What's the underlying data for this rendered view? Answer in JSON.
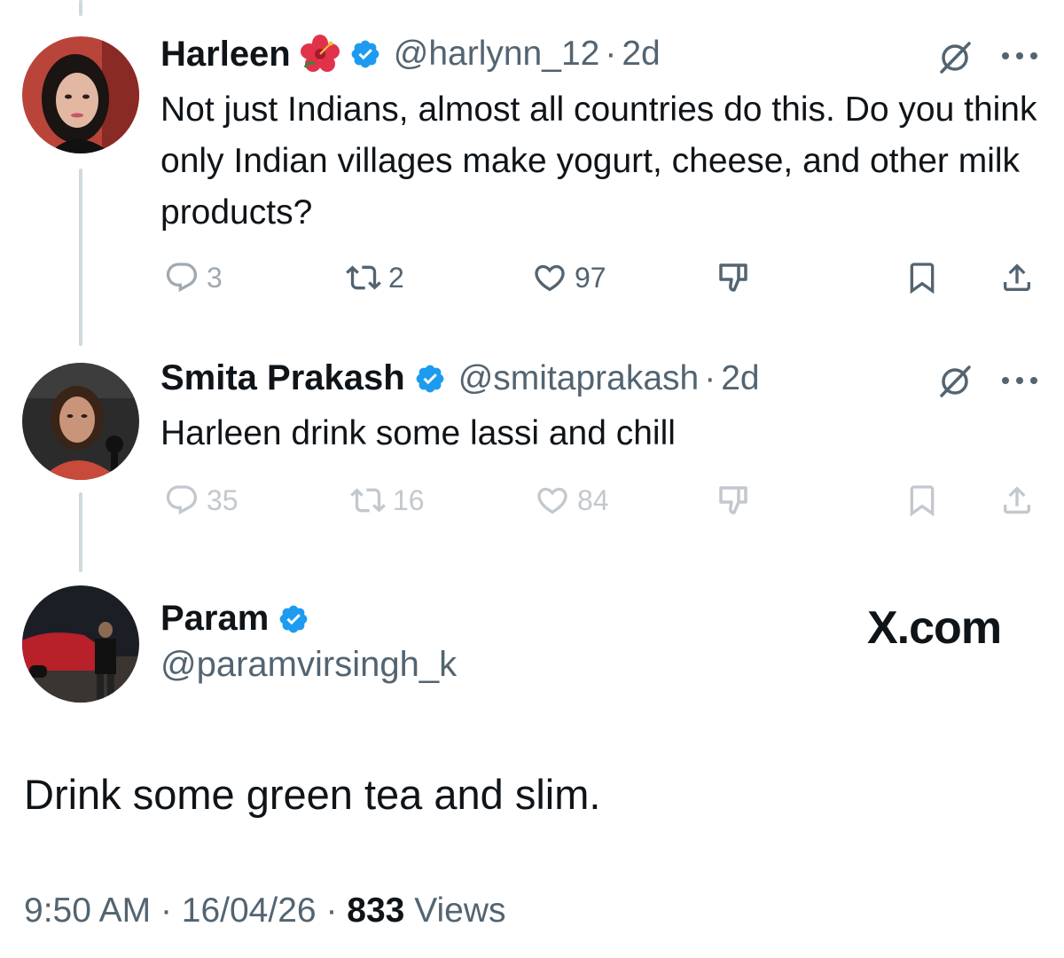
{
  "tweets": [
    {
      "name": "Harleen",
      "handle": "@harlynn_12",
      "dot": "·",
      "time": "2d",
      "text": "Not just Indians, almost all countries do this. Do you think only Indian villages make yogurt, cheese, and other milk products?",
      "replies": "3",
      "reposts": "2",
      "likes": "97"
    },
    {
      "name": "Smita Prakash",
      "handle": "@smitaprakash",
      "dot": "·",
      "time": "2d",
      "text": "Harleen drink some lassi and chill",
      "replies": "35",
      "reposts": "16",
      "likes": "84"
    }
  ],
  "main": {
    "name": "Param",
    "handle": "@paramvirsingh_k",
    "brand": "X.com",
    "text": "Drink some green tea and slim.",
    "time": "9:50 AM",
    "sep1": "·",
    "date": "16/04/26",
    "sep2": "·",
    "views_count": "833",
    "views_label": "Views"
  },
  "colors": {
    "verified": "#1d9bf0",
    "secondary_text": "#536471",
    "primary_text": "#0f1419",
    "thread_line": "#cfd9de"
  },
  "icons": [
    "hibiscus-icon",
    "verified-badge-icon",
    "grok-icon",
    "more-icon",
    "reply-icon",
    "repost-icon",
    "like-icon",
    "dislike-icon",
    "bookmark-icon",
    "share-icon"
  ]
}
